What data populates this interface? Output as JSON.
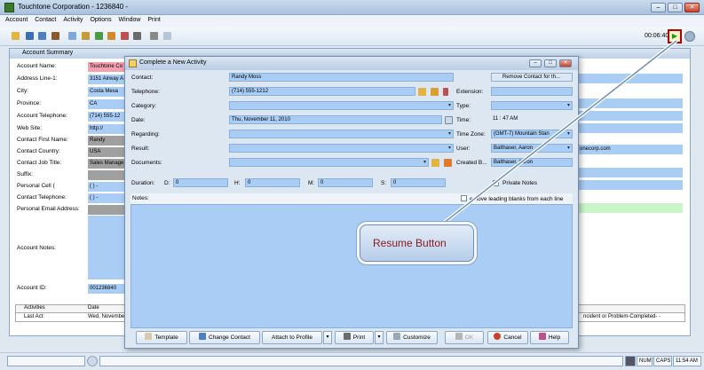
{
  "window": {
    "title": "Touchtone Corporation - 1236840 -",
    "minimize": "–",
    "maximize": "□",
    "close": "✕"
  },
  "menu": [
    "Account",
    "Contact",
    "Activity",
    "Options",
    "Window",
    "Print"
  ],
  "toolbar": {
    "timer": "00:06:40",
    "resume_glyph": "▶"
  },
  "account_summary": {
    "title": "Account Summary",
    "fields": [
      {
        "label": "Account Name:",
        "value": "Touchtone Co"
      },
      {
        "label": "Address Line-1:",
        "value": "3151 Airway A"
      },
      {
        "label": "City:",
        "value": "Costa Mesa"
      },
      {
        "label": "Province:",
        "value": "CA"
      },
      {
        "label": "Account Telephone:",
        "value": "(714) 555-12"
      },
      {
        "label": "Web Site:",
        "value": "http://"
      },
      {
        "label": "Contact First Name:",
        "value": "Randy"
      },
      {
        "label": "Contact Country:",
        "value": "USA"
      },
      {
        "label": "Contact Job Title:",
        "value": "Sales Manage"
      },
      {
        "label": "Suffix:",
        "value": ""
      },
      {
        "label": "Personal Cell (",
        "value": "( )  -"
      },
      {
        "label": "Contact Telephone:",
        "value": "( )  -"
      },
      {
        "label": "Personal Email Address:",
        "value": ""
      }
    ],
    "notes_label": "Account Notes:",
    "account_id_label": "Account ID:",
    "account_id": "001236840",
    "right_web": "onecorp.com",
    "grid": {
      "headers": [
        "Activities",
        "Date"
      ],
      "row": [
        "Last Act:",
        "Wed, November"
      ],
      "right_text": "ncident or Problem-Completed- -"
    }
  },
  "dialog": {
    "title": "Complete a New Activity",
    "contact_label": "Contact:",
    "contact": "Randy Moss",
    "remove_contact": "Remove Contact for th...",
    "telephone_label": "Telephone:",
    "telephone": "(714) 555-1212",
    "extension_label": "Extension:",
    "category_label": "Category:",
    "type_label": "Type:",
    "date_label": "Date:",
    "date": "Thu, November 11, 2010",
    "time_label": "Time:",
    "time": "11 : 47   AM",
    "regarding_label": "Regarding:",
    "timezone_label": "Time Zone:",
    "timezone": "(GMT-7) Mountain Stan",
    "result_label": "Result:",
    "user_label": "User:",
    "user": "Balthaser, Aaron",
    "documents_label": "Documents:",
    "created_label": "Created B...",
    "created_by": "Balthaser, Aaron",
    "duration_label": "Duration:",
    "d_label": "D:",
    "d": "0",
    "h_label": "H:",
    "h": "0",
    "m_label": "M:",
    "m": "0",
    "s_label": "S:",
    "s": "0",
    "private_notes": "Private Notes",
    "notes_label": "Notes:",
    "remove_blanks": "emove leading blanks from each line",
    "buttons": {
      "template": "Template",
      "change_contact": "Change Contact",
      "attach": "Attach to Profile",
      "print": "Print",
      "customize": "Customize",
      "ok": "OK",
      "cancel": "Cancel",
      "help": "Help"
    }
  },
  "callout": {
    "text": "Resume Button"
  },
  "statusbar": {
    "num": "NUM",
    "caps": "CAPS",
    "clock": "11:54 AM"
  }
}
